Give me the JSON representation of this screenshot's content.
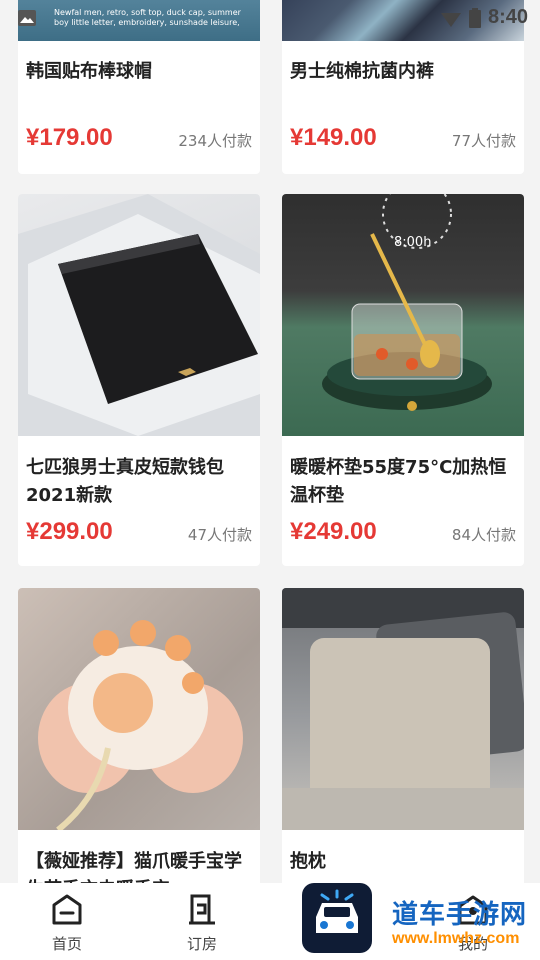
{
  "status_bar": {
    "time": "8:40",
    "left_icon": "gallery-icon",
    "signal_icon": "signal-icon",
    "battery_icon": "battery-icon"
  },
  "top_banner_text": "Newfal men, retro, soft top, duck cap, summer boy little letter, embroidery, sunshade leisure, cowboy baseball cap",
  "currency": "¥",
  "products": [
    {
      "name": "韩国贴布棒球帽",
      "price": "¥179.00",
      "sold": "234人付款"
    },
    {
      "name": "男士纯棉抗菌内裤",
      "price": "¥149.00",
      "sold": "77人付款"
    },
    {
      "name": "七匹狼男士真皮短款钱包2021新款",
      "price": "¥299.00",
      "sold": "47人付款",
      "image_text": ""
    },
    {
      "name": "暖暖杯垫55度75°C加热恒温杯垫",
      "price": "¥249.00",
      "sold": "84人付款",
      "image_text": "8:00h"
    },
    {
      "name": "【薇娅推荐】猫爪暖手宝学生节手充电暖手宝",
      "price": "",
      "sold": ""
    },
    {
      "name": "抱枕",
      "price": "",
      "sold": ""
    }
  ],
  "tabbar": {
    "tabs": [
      {
        "label": "首页",
        "icon": "home-icon"
      },
      {
        "label": "订房",
        "icon": "order-icon"
      },
      {
        "label": "",
        "icon": "car-icon"
      },
      {
        "label": "我的",
        "icon": "profile-icon"
      }
    ]
  },
  "watermark": {
    "title": "道车手游网",
    "url": "www.lmwhz.com"
  },
  "colors": {
    "price": "#e53935",
    "background": "#f3f3f3",
    "card": "#ffffff",
    "watermark_blue": "#1565c0",
    "watermark_orange": "#ff8f00"
  }
}
